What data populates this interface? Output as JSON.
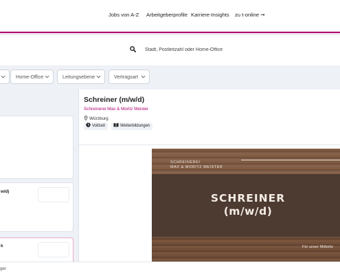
{
  "nav": {
    "links": [
      "Jobs von A-Z",
      "Arbeitgeberprofile",
      "Karriere-Insights",
      "zu t-online"
    ],
    "accent_color": "#b0006e"
  },
  "search": {
    "icon": "search-icon",
    "placeholder": "Stadt, Postleitzahl oder Home-Office"
  },
  "filters": [
    "Home-Office",
    "Leitungsebene",
    "Vertragsart"
  ],
  "results": {
    "card_fragments": [
      "w/d)",
      "k"
    ]
  },
  "detail": {
    "title": "Schreiner (m/w/d)",
    "company": "Schreinerei Max & Moritz Meister",
    "location": "Würzburg",
    "tags": [
      "Vollzeit",
      "Weiterbildungen"
    ],
    "banner": {
      "brand_line1": "SCHREINEREI",
      "brand_line2": "MAX & MORITZ MEISTER",
      "title": "SCHREINER",
      "subtitle": "(m/w/d)",
      "tagline": "Für unser Möbelw"
    }
  },
  "footer": {
    "text": "ger"
  }
}
